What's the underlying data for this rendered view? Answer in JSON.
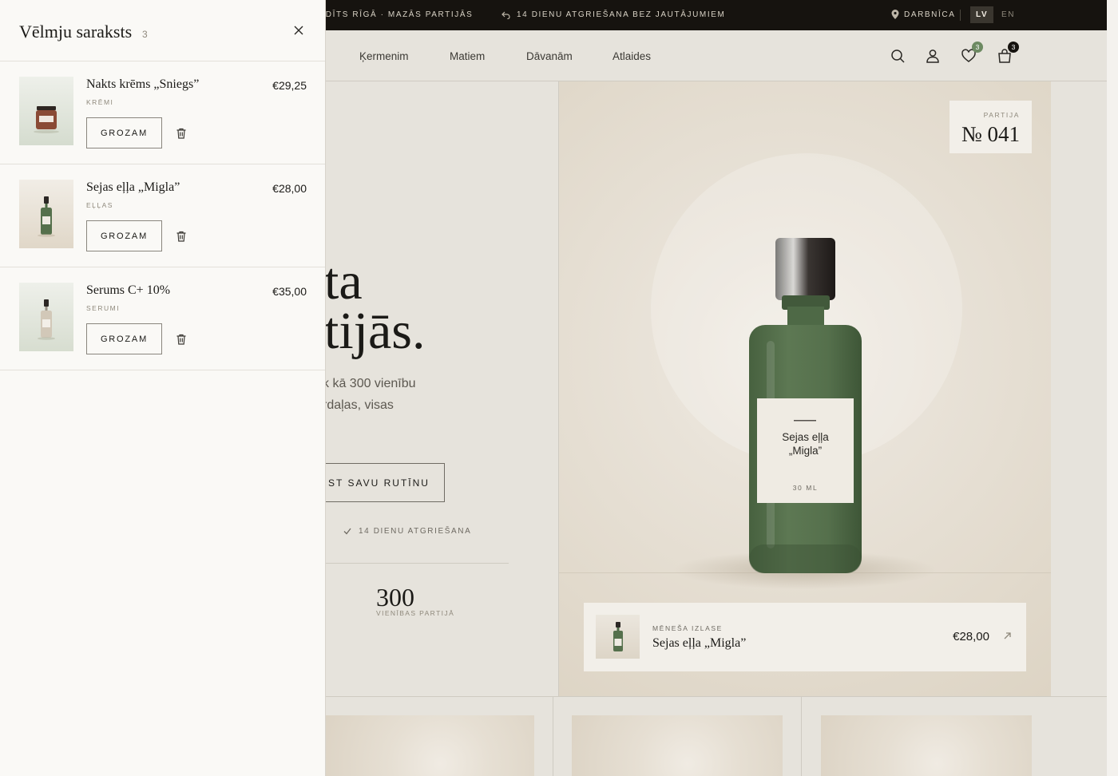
{
  "topbar": {
    "msg1": "PILDĪTS RĪGĀ · MAZĀS PARTIJĀS",
    "msg2": "14 DIENU ATGRIEŠANA BEZ JAUTĀJUMIEM",
    "workshop": "DARBNĪCA",
    "lang_lv": "LV",
    "lang_en": "EN"
  },
  "nav": {
    "items": [
      "Ķermenim",
      "Matiem",
      "Dāvanām",
      "Atlaides"
    ],
    "wishlist_count": "3",
    "cart_count": "3"
  },
  "hero": {
    "title_line1": "ta",
    "title_line2": "tijās.",
    "sub_line1": "k kā 300 vienību",
    "sub_line2": "rdaļas, visas",
    "cta": "ST SAVU RUTĪNU",
    "returns_note": "14 DIENU ATGRIEŠANA",
    "stat_number": "300",
    "stat_label": "VIENĪBAS PARTIJĀ"
  },
  "hero_image": {
    "batch_label": "PARTIJA",
    "batch_number": "№ 041",
    "bottle_label_name": "Sejas eļļa „Migla”",
    "bottle_label_volume": "30 ML",
    "featured_kicker": "MĒNEŠA IZLASE",
    "featured_name": "Sejas eļļa „Migla”",
    "featured_price": "€28,00"
  },
  "wishlist": {
    "title": "Vēlmju saraksts",
    "count": "3",
    "items": [
      {
        "name": "Nakts krēms „Sniegs”",
        "category": "KRĒMI",
        "price": "€29,25",
        "button": "GROZAM"
      },
      {
        "name": "Sejas eļļa „Migla”",
        "category": "EĻĻAS",
        "price": "€28,00",
        "button": "GROZAM"
      },
      {
        "name": "Serums C+ 10%",
        "category": "SERUMI",
        "price": "€35,00",
        "button": "GROZAM"
      }
    ]
  },
  "colors": {
    "topbar_bg": "#16130f",
    "page_bg": "#e6e3dc",
    "drawer_bg": "#faf9f6",
    "bottle_green": "#55704c",
    "accent_green": "#6d8a62"
  }
}
